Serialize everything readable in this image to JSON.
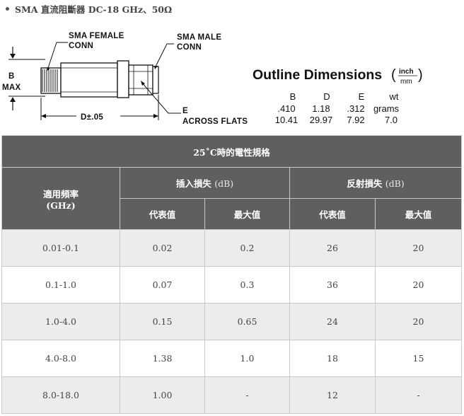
{
  "header": {
    "title": "SMA 直流阻斷器 DC-18 GHz、50Ω"
  },
  "drawing": {
    "labels": {
      "female_conn_1": "SMA FEMALE",
      "female_conn_2": "CONN",
      "male_conn_1": "SMA MALE",
      "male_conn_2": "CONN",
      "b_max_1": "B",
      "b_max_2": "MAX",
      "d_tol": "D±.05",
      "e_1": "E",
      "e_2": "ACROSS FLATS"
    },
    "outline": {
      "title": "Outline Dimensions",
      "unit_top": "inch",
      "unit_bottom": "mm",
      "columns": [
        "B",
        "D",
        "E",
        "wt"
      ],
      "inch_row": [
        ".410",
        "1.18",
        ".312",
        "grams"
      ],
      "mm_row": [
        "10.41",
        "29.97",
        "7.92",
        "7.0"
      ]
    }
  },
  "table": {
    "title": "25˚C時的電性規格",
    "freq_header": "適用頻率",
    "freq_unit": "(GHz)",
    "insertion_loss_header": "插入損失",
    "insertion_loss_unit": "(dB)",
    "return_loss_header": "反射損失",
    "return_loss_unit": "(dB)",
    "typical": "代表值",
    "maximum": "最大值",
    "rows": [
      {
        "freq": "0.01-0.1",
        "il_typ": "0.02",
        "il_max": "0.2",
        "rl_typ": "26",
        "rl_min": "20"
      },
      {
        "freq": "0.1-1.0",
        "il_typ": "0.07",
        "il_max": "0.3",
        "rl_typ": "36",
        "rl_min": "20"
      },
      {
        "freq": "1.0-4.0",
        "il_typ": "0.15",
        "il_max": "0.65",
        "rl_typ": "24",
        "rl_min": "20"
      },
      {
        "freq": "4.0-8.0",
        "il_typ": "1.38",
        "il_max": "1.0",
        "rl_typ": "18",
        "rl_min": "15"
      },
      {
        "freq": "8.0-18.0",
        "il_typ": "1.00",
        "il_max": "-",
        "rl_typ": "12",
        "rl_min": "-"
      }
    ]
  }
}
